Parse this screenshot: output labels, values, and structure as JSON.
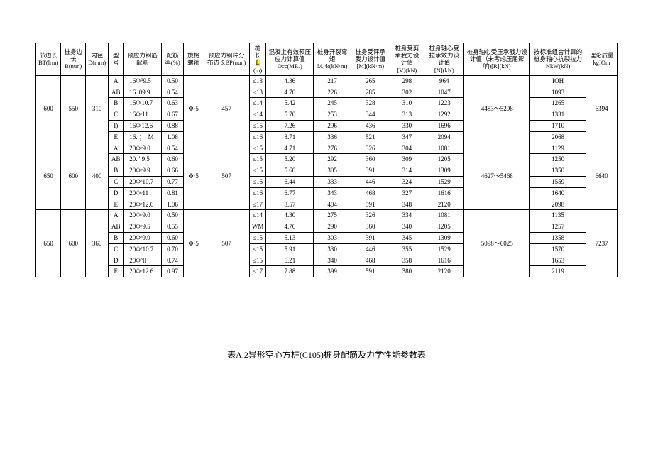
{
  "headers": {
    "c1a": "节边长",
    "c1b": "BT(lrm)",
    "c2a": "桩身边长",
    "c2b": "B(nun)",
    "c3a": "内径",
    "c3b": "D(mm)",
    "c4": "型号",
    "c5": "预应力钢筋配筋",
    "c6a": "配筋率(%)",
    "c7a": "旋格螺箍",
    "c8a": "预应力钢棒分布边长BP(nun)",
    "c9a": "桩长",
    "c9b": "L",
    "c9c": "(m)",
    "c10a": "混凝上有效预压应力计算值",
    "c10b": "Occ(MP..)",
    "c11a": "桩身开裂弯矩",
    "c11b": "Mₒ·k(kN·m)",
    "c12a": "桩身受评承我力设计值",
    "c12b": "[M](kN·m)",
    "c13a": "桩身受剪承我力设计值",
    "c13b": "[V](kN)",
    "c14a": "桩身轴心受拉承效力设计值",
    "c14b": "[N](kN)",
    "c15a": "桩身轴心受压承戳力设计值（未考虑压屈影响)[R](kN)",
    "c16a": "按标准组合计算的桩身轴心抗裂拉力",
    "c16b": "NkW(kN)",
    "c17a": "理论质量kgIOm"
  },
  "groups": [
    {
      "bt": "600",
      "b": "550",
      "d": "310",
      "phi": "Φ·5",
      "bp": "457",
      "r": "4483～5298",
      "mass": "6394",
      "rows": [
        {
          "t": "A",
          "reb": "16Φ⁰9.5",
          "rr": "0.50",
          "l": "≤13",
          "occ": "4.36",
          "m": "217",
          "mm": "265",
          "v": "298",
          "n": "964",
          "nk": "IOH"
        },
        {
          "t": "AB",
          "reb": "16.   09.9",
          "rr": "0.54",
          "l": "≤13",
          "occ": "4.70",
          "m": "226",
          "mm": "285",
          "v": "302",
          "n": "1047",
          "nk": "1093"
        },
        {
          "t": "B",
          "reb": "16Φᶦ10.7",
          "rr": "0.63",
          "l": "≤14",
          "occ": "5.42",
          "m": "245",
          "mm": "328",
          "v": "310",
          "n": "1223",
          "nk": "1265"
        },
        {
          "t": "C",
          "reb": "16Φᵉ11",
          "rr": "0.67",
          "l": "≤14",
          "occ": "5.70",
          "m": "253",
          "mm": "344",
          "v": "313",
          "n": "1292",
          "nk": "1331"
        },
        {
          "t": "I)",
          "reb": "16Φᶦ12.6",
          "rr": "0.88",
          "l": "≤15",
          "occ": "7.26",
          "m": "296",
          "mm": "436",
          "v": "330",
          "n": "1696",
          "nk": "1710"
        },
        {
          "t": "E",
          "reb": "16.   ；' M",
          "rr": "1.08",
          "l": "≤16",
          "occ": "8.71",
          "m": "336",
          "mm": "521",
          "v": "347",
          "n": "2094",
          "nk": "2068"
        }
      ]
    },
    {
      "bt": "650",
      "b": "600",
      "d": "400",
      "phi": "Φ·5",
      "bp": "507",
      "r": "4627～5468",
      "mass": "6640",
      "rows": [
        {
          "t": "A",
          "reb": "20Φᵒ9.0",
          "rr": "0.54",
          "l": "≤15",
          "occ": "4.71",
          "m": "276",
          "mm": "326",
          "v": "304",
          "n": "1081",
          "nk": "1129"
        },
        {
          "t": "AB",
          "reb": "20.   ' 9.5",
          "rr": "0.60",
          "l": "≤15",
          "occ": "5.20",
          "m": "292",
          "mm": "360",
          "v": "309",
          "n": "1205",
          "nk": "1250"
        },
        {
          "t": "B",
          "reb": "20Φᵒ9.9",
          "rr": "0.66",
          "l": "≤15",
          "occ": "5.60",
          "m": "305",
          "mm": "391",
          "v": "314",
          "n": "1309",
          "nk": "1350"
        },
        {
          "t": "C",
          "reb": "20Φᵒ10.7",
          "rr": "0.77",
          "l": "≤16",
          "occ": "6.44",
          "m": "333",
          "mm": "446",
          "v": "324",
          "n": "1529",
          "nk": "1559"
        },
        {
          "t": "D",
          "reb": "20Φᵒ11",
          "rr": "0.81",
          "l": "≤16",
          "occ": "6.77",
          "m": "343",
          "mm": "468",
          "v": "327",
          "n": "1616",
          "nk": "1640"
        },
        {
          "t": "E",
          "reb": "20Φᵒ12.6",
          "rr": "1.06",
          "l": "≤17",
          "occ": "8.57",
          "m": "404",
          "mm": "591",
          "v": "348",
          "n": "2120",
          "nk": "2098"
        }
      ]
    },
    {
      "bt": "650",
      "b": "600",
      "d": "360",
      "phi": "Φ·5",
      "bp": "507",
      "r": "5098～6025",
      "mass": "7237",
      "rows": [
        {
          "t": "A",
          "reb": "20Φᵒ9.0",
          "rr": "0.50",
          "l": "≤14",
          "occ": "4.30",
          "m": "275",
          "mm": "326",
          "v": "334",
          "n": "1081",
          "nk": "1135"
        },
        {
          "t": "AB",
          "reb": "20Φᵒ9.5",
          "rr": "0.55",
          "l": "WM",
          "occ": "4.76",
          "m": "290",
          "mm": "360",
          "v": "340",
          "n": "1205",
          "nk": "1257"
        },
        {
          "t": "B",
          "reb": "20Φᵒ9.9",
          "rr": "0.60",
          "l": "≤15",
          "occ": "5.13",
          "m": "303",
          "mm": "391",
          "v": "345",
          "n": "1309",
          "nk": "1358"
        },
        {
          "t": "C",
          "reb": "20Φº10.7",
          "rr": "0.70",
          "l": "≤15",
          "occ": "5.91",
          "m": "330",
          "mm": "446",
          "v": "355",
          "n": "1529",
          "nk": "1570"
        },
        {
          "t": "D",
          "reb": "20ΦºIl",
          "rr": "0.74",
          "l": "≤15",
          "occ": "6.21",
          "m": "340",
          "mm": "468",
          "v": "358",
          "n": "1616",
          "nk": "1653"
        },
        {
          "t": "E",
          "reb": "20Φᵒ12.6",
          "rr": "0.97",
          "l": "≤17",
          "occ": "7.88",
          "m": "399",
          "mm": "591",
          "v": "380",
          "n": "2120",
          "nk": "2119"
        }
      ]
    }
  ],
  "caption": "表A.2异形空心方桩(C105)桩身配筋及力学性能参数表"
}
